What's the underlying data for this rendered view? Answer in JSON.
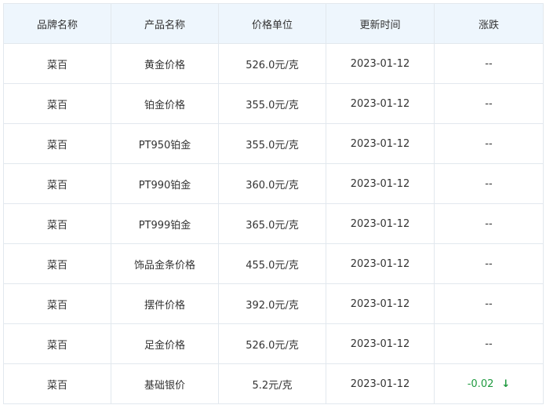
{
  "table": {
    "headers": [
      "品牌名称",
      "产品名称",
      "价格单位",
      "更新时间",
      "涨跌"
    ],
    "rows": [
      {
        "brand": "菜百",
        "product": "黄金价格",
        "price": "526.0元/克",
        "date": "2023-01-12",
        "change": "--"
      },
      {
        "brand": "菜百",
        "product": "铂金价格",
        "price": "355.0元/克",
        "date": "2023-01-12",
        "change": "--"
      },
      {
        "brand": "菜百",
        "product": "PT950铂金",
        "price": "355.0元/克",
        "date": "2023-01-12",
        "change": "--"
      },
      {
        "brand": "菜百",
        "product": "PT990铂金",
        "price": "360.0元/克",
        "date": "2023-01-12",
        "change": "--"
      },
      {
        "brand": "菜百",
        "product": "PT999铂金",
        "price": "365.0元/克",
        "date": "2023-01-12",
        "change": "--"
      },
      {
        "brand": "菜百",
        "product": "饰品金条价格",
        "price": "455.0元/克",
        "date": "2023-01-12",
        "change": "--"
      },
      {
        "brand": "菜百",
        "product": "摆件价格",
        "price": "392.0元/克",
        "date": "2023-01-12",
        "change": "--"
      },
      {
        "brand": "菜百",
        "product": "足金价格",
        "price": "526.0元/克",
        "date": "2023-01-12",
        "change": "--"
      },
      {
        "brand": "菜百",
        "product": "基础银价",
        "price": "5.2元/克",
        "date": "2023-01-12",
        "change": "-0.02",
        "trend_icon": "arrow-down-icon",
        "trend_arrow": "↓"
      }
    ]
  },
  "colors": {
    "header_bg": "#eef6fd",
    "border": "#e2e8ee",
    "text": "#333333",
    "down": "#1f9a3f"
  }
}
